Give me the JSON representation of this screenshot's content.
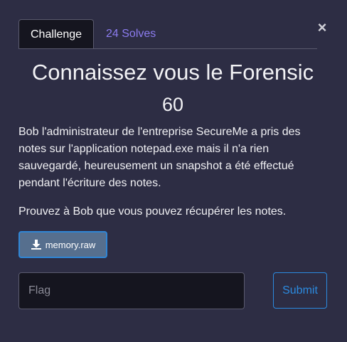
{
  "tabs": [
    {
      "label": "Challenge",
      "active": true
    },
    {
      "label": "24 Solves",
      "active": false
    }
  ],
  "close_label": "×",
  "challenge": {
    "title": "Connaissez vous le Forensic",
    "value": "60",
    "description": "Bob l'administrateur de l'entreprise SecureMe a pris des notes sur l'application notepad.exe mais il n'a rien sauvegardé, heureusement un snapshot a été effectué pendant l'écriture des notes.",
    "description2": "Prouvez à Bob que vous pouvez récupérer les notes.",
    "file": {
      "name": "memory.raw",
      "icon": "download-icon"
    }
  },
  "form": {
    "flag_placeholder": "Flag",
    "flag_value": "",
    "submit_label": "Submit"
  },
  "colors": {
    "background": "#2d2d44",
    "tab_active_bg": "#15151f",
    "link": "#8c7cf0",
    "primary": "#2c8be0",
    "file_button_bg": "#566f8e"
  }
}
